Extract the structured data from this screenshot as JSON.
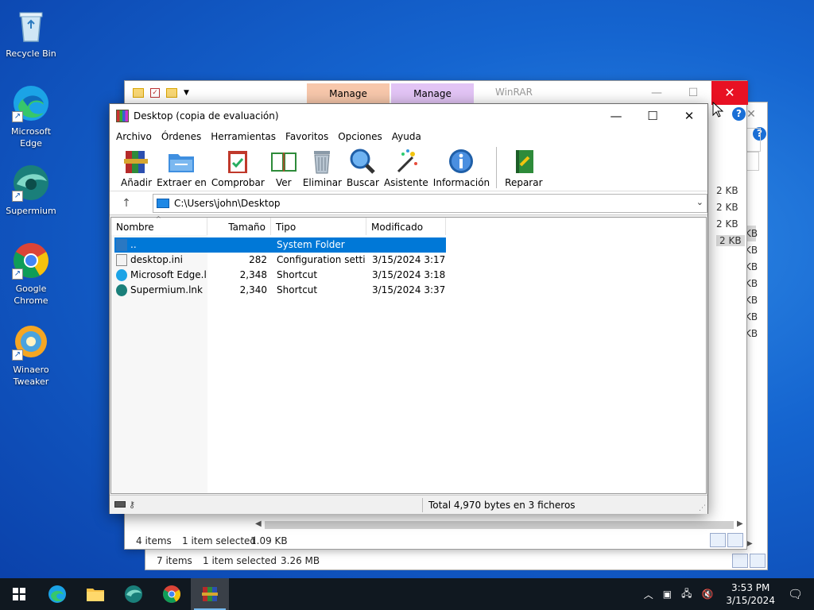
{
  "desktop": {
    "icons": [
      {
        "label": "Recycle Bin"
      },
      {
        "label": "Microsoft Edge"
      },
      {
        "label": "Supermium"
      },
      {
        "label": "Google Chrome"
      },
      {
        "label": "Winaero Tweaker"
      }
    ]
  },
  "bg_window1": {
    "tab_manage_1": "Manage",
    "tab_manage_2": "Manage",
    "title": "WinRAR",
    "sizes": [
      "2 KB",
      "2 KB",
      "2 KB",
      "2 KB"
    ],
    "status_items": "4 items",
    "status_selected": "1 item selected",
    "status_size": "1.09 KB"
  },
  "bg_window2": {
    "partial_sizes": [
      "KB",
      "KB",
      "KB",
      "KB",
      "KB",
      "KB",
      "KB"
    ],
    "status_items": "7 items",
    "status_selected": "1 item selected",
    "status_size": "3.26 MB"
  },
  "winrar": {
    "title": "Desktop (copia de evaluación)",
    "menu": [
      "Archivo",
      "Órdenes",
      "Herramientas",
      "Favoritos",
      "Opciones",
      "Ayuda"
    ],
    "toolbar": [
      {
        "label": "Añadir"
      },
      {
        "label": "Extraer en"
      },
      {
        "label": "Comprobar"
      },
      {
        "label": "Ver"
      },
      {
        "label": "Eliminar"
      },
      {
        "label": "Buscar"
      },
      {
        "label": "Asistente"
      },
      {
        "label": "Información"
      },
      {
        "label": "Reparar"
      }
    ],
    "path": "C:\\Users\\john\\Desktop",
    "columns": {
      "name": "Nombre",
      "size": "Tamaño",
      "type": "Tipo",
      "modified": "Modificado"
    },
    "files": [
      {
        "name": "..",
        "size": "",
        "type": "System Folder",
        "modified": ""
      },
      {
        "name": "desktop.ini",
        "size": "282",
        "type": "Configuration setti...",
        "modified": "3/15/2024 3:17 ..."
      },
      {
        "name": "Microsoft Edge.l...",
        "size": "2,348",
        "type": "Shortcut",
        "modified": "3/15/2024 3:18 ..."
      },
      {
        "name": "Supermium.lnk",
        "size": "2,340",
        "type": "Shortcut",
        "modified": "3/15/2024 3:37 ..."
      }
    ],
    "status_total": "Total 4,970 bytes en 3 ficheros"
  },
  "taskbar": {
    "time": "3:53 PM",
    "date": "3/15/2024"
  },
  "colors": {
    "accent": "#0078d7",
    "close_red": "#e81123",
    "taskbar": "#101820"
  }
}
